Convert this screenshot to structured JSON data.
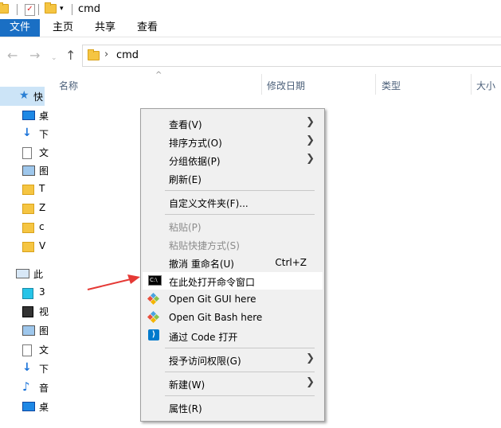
{
  "window": {
    "title": "cmd"
  },
  "ribbon": {
    "tabs": [
      {
        "label": "文件",
        "active": true
      },
      {
        "label": "主页"
      },
      {
        "label": "共享"
      },
      {
        "label": "查看"
      }
    ]
  },
  "address": {
    "path_segment": "cmd",
    "chevron": "›"
  },
  "nav": {
    "quick_access_label": "快",
    "this_pc_label": "此",
    "items": [
      {
        "icon": "desktop-icon",
        "label": "桌"
      },
      {
        "icon": "download-icon",
        "label": "下"
      },
      {
        "icon": "document-icon",
        "label": "文"
      },
      {
        "icon": "picture-icon",
        "label": "图"
      },
      {
        "icon": "folder-icon",
        "label": "T"
      },
      {
        "icon": "folder-icon",
        "label": "Z"
      },
      {
        "icon": "folder-icon",
        "label": "c"
      },
      {
        "icon": "folder-icon",
        "label": "V"
      }
    ],
    "pc_items": [
      {
        "icon": "3d-objects-icon",
        "label": "3"
      },
      {
        "icon": "video-icon",
        "label": "视"
      },
      {
        "icon": "picture-icon",
        "label": "图"
      },
      {
        "icon": "document-icon",
        "label": "文"
      },
      {
        "icon": "download-icon",
        "label": "下"
      },
      {
        "icon": "music-icon",
        "label": "音"
      },
      {
        "icon": "desktop-icon",
        "label": "桌"
      }
    ]
  },
  "columns": {
    "name": "名称",
    "modified": "修改日期",
    "type": "类型",
    "size": "大小"
  },
  "context_menu": {
    "view": "查看(V)",
    "sort_by": "排序方式(O)",
    "group_by": "分组依据(P)",
    "refresh": "刷新(E)",
    "customize_folder": "自定义文件夹(F)...",
    "paste": "粘贴(P)",
    "paste_shortcut": "粘贴快捷方式(S)",
    "undo_rename": "撤消 重命名(U)",
    "undo_shortcut": "Ctrl+Z",
    "open_cmd_here": "在此处打开命令窗口",
    "open_git_gui": "Open Git GUI here",
    "open_git_bash": "Open Git Bash here",
    "open_with_code": "通过 Code 打开",
    "give_access": "授予访问权限(G)",
    "new": "新建(W)",
    "properties": "属性(R)"
  },
  "colors": {
    "accent": "#1a6fc4",
    "menu_bg": "#f0f0f0",
    "arrow": "#e53935"
  }
}
